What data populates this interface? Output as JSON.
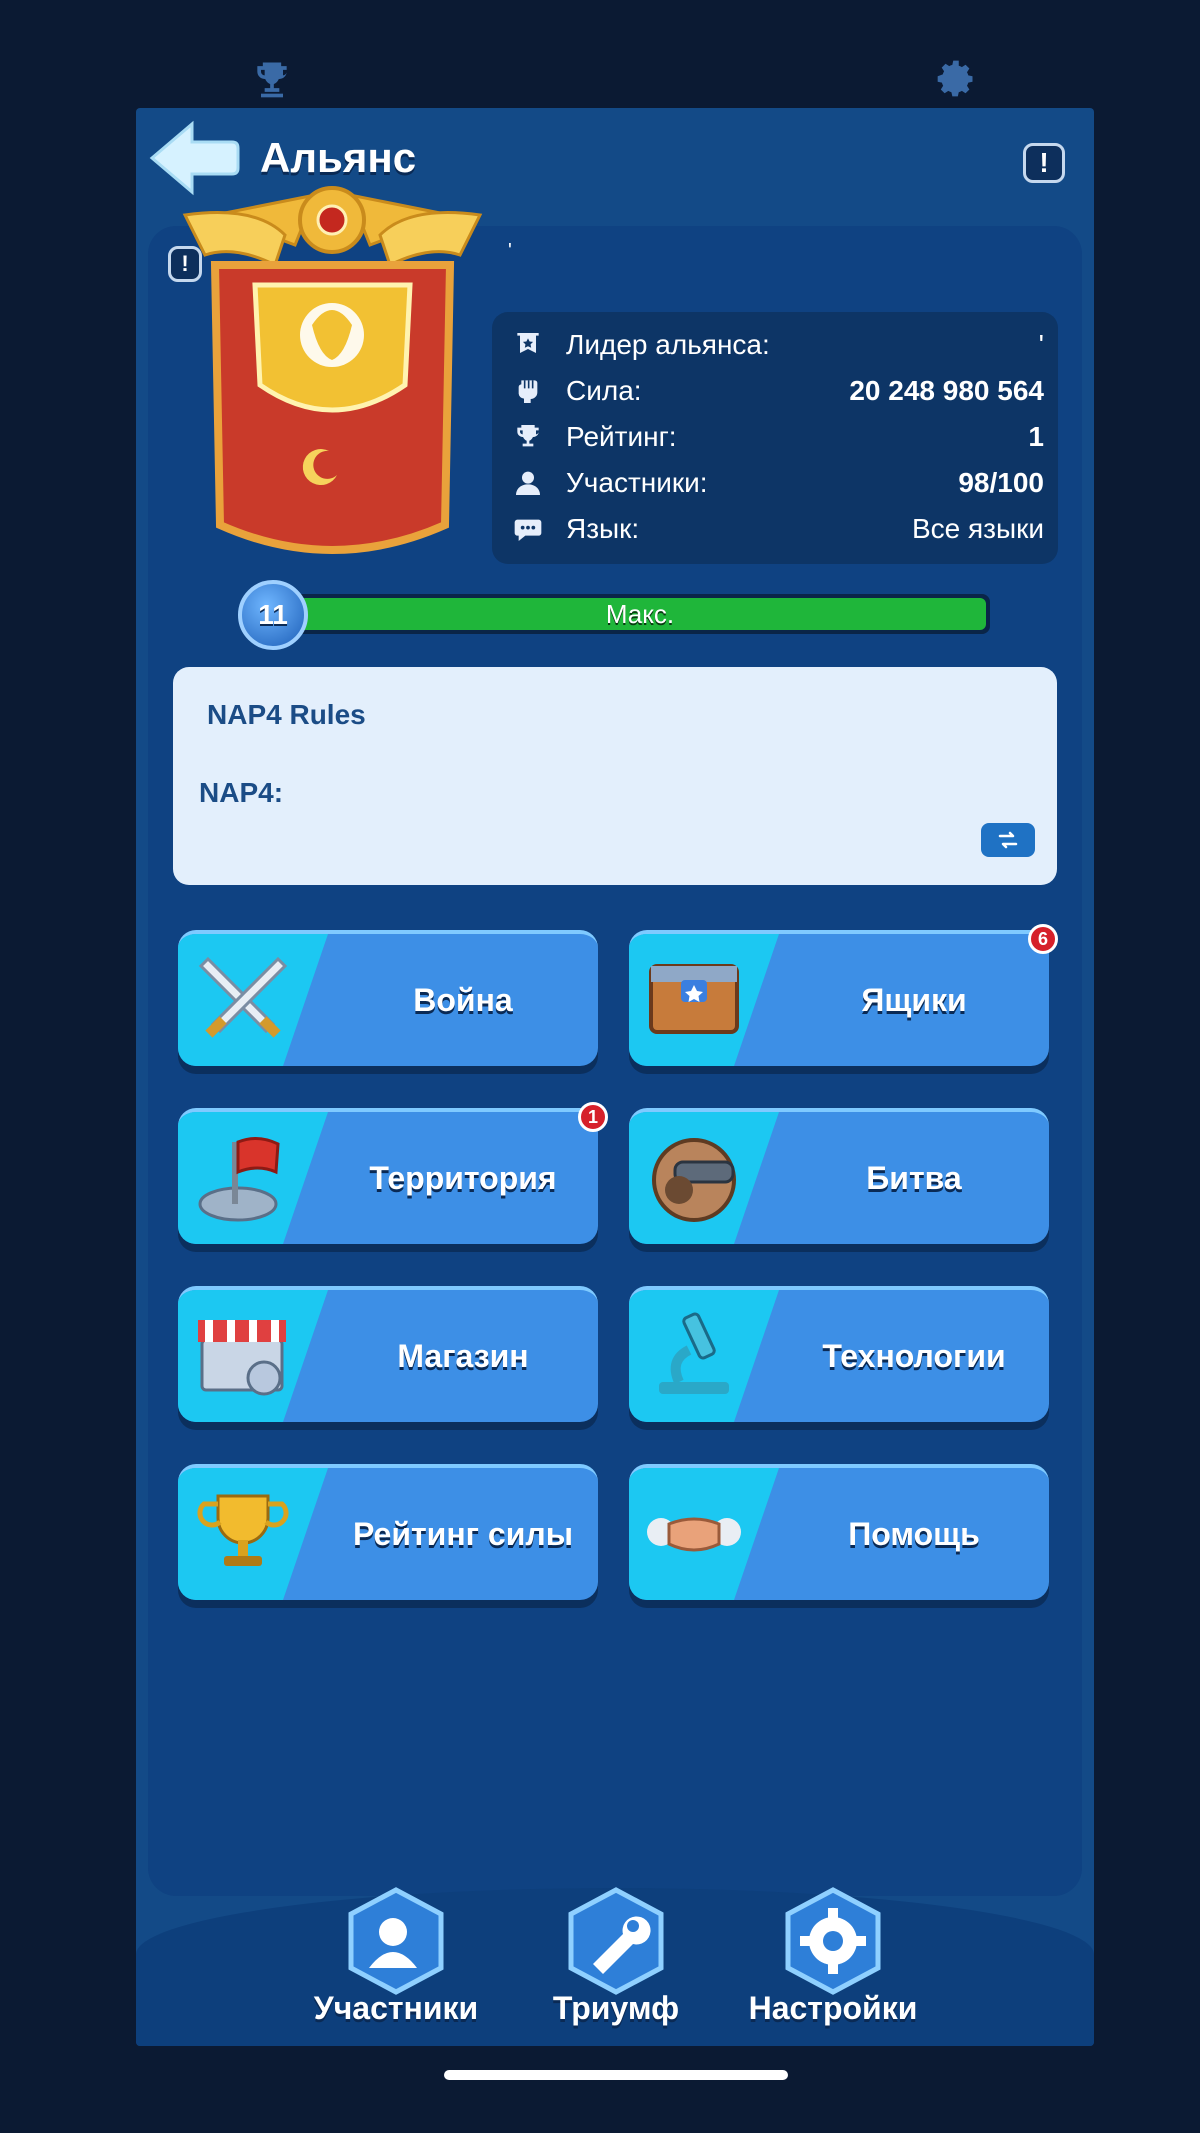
{
  "topbar": {
    "left_icon": "trophy-icon",
    "right_icon": "gear-icon"
  },
  "header": {
    "title": "Альянс",
    "back_icon": "back-arrow-icon",
    "info_icon": "exclamation-icon"
  },
  "alliance": {
    "name_mark": "'",
    "stats": [
      {
        "icon": "leader-banner-icon",
        "label": "Лидер альянса:",
        "value": "'"
      },
      {
        "icon": "fist-icon",
        "label": "Сила:",
        "value": "20 248 980 564"
      },
      {
        "icon": "trophy-icon",
        "label": "Рейтинг:",
        "value": "1"
      },
      {
        "icon": "person-icon",
        "label": "Участники:",
        "value": "98/100"
      },
      {
        "icon": "chat-icon",
        "label": "Язык:",
        "value": "Все языки"
      }
    ]
  },
  "level": {
    "number": "11",
    "bar_text": "Макс.",
    "progress": 1.0
  },
  "description": {
    "title": "NAP4 Rules",
    "body": "NAP4:",
    "translate_icon": "swap-arrows-icon"
  },
  "menu": [
    {
      "label": "Война",
      "icon": "crossed-swords-icon",
      "badge": ""
    },
    {
      "label": "Ящики",
      "icon": "chest-icon",
      "badge": "6"
    },
    {
      "label": "Территория",
      "icon": "flag-icon",
      "badge": "1"
    },
    {
      "label": "Битва",
      "icon": "cannon-icon",
      "badge": ""
    },
    {
      "label": "Магазин",
      "icon": "shop-icon",
      "badge": ""
    },
    {
      "label": "Технологии",
      "icon": "microscope-icon",
      "badge": ""
    },
    {
      "label": "Рейтинг силы",
      "icon": "trophy-cup-icon",
      "badge": ""
    },
    {
      "label": "Помощь",
      "icon": "handshake-icon",
      "badge": ""
    }
  ],
  "bottom_nav": [
    {
      "label": "Участники",
      "icon": "members-icon"
    },
    {
      "label": "Триумф",
      "icon": "wrench-icon"
    },
    {
      "label": "Настройки",
      "icon": "gear-icon"
    }
  ],
  "colors": {
    "background": "#0b1a33",
    "panel": "#134a87",
    "button_blue": "#3d8fe6",
    "button_cyan": "#1cc8f2",
    "progress_green": "#1fb63a",
    "badge_red": "#d6202a"
  }
}
